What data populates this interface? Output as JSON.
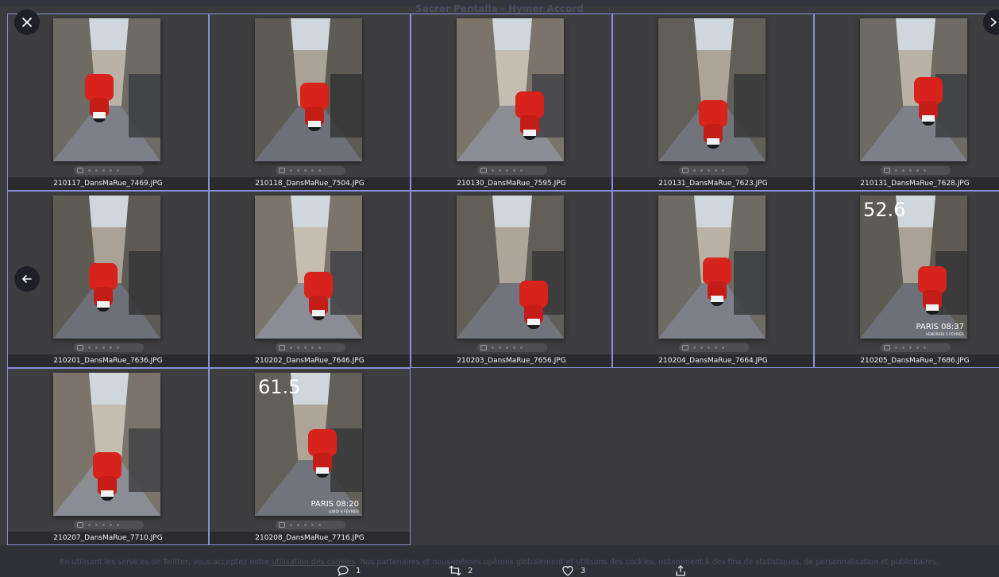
{
  "background_page": {
    "title": "Sacrer Pentalla - Hymer Accord",
    "cookie_text_before": "En utilisant les services de Twitter, vous acceptez notre",
    "cookie_link": "utilisation des cookies",
    "cookie_text_after": ". Nos partenaires et nous-mêmes opérons globalement et utilisons des cookies, notamment à des fins de statistiques, de personnalisation et publicitaires."
  },
  "viewer": {
    "close_icon": "close-icon",
    "prev_icon": "arrow-left-icon",
    "next_icon": "chevron-right-icon"
  },
  "thumbnails": [
    {
      "filename": "210117_DansMaRue_7469.JPG"
    },
    {
      "filename": "210118_DansMaRue_7504.JPG"
    },
    {
      "filename": "210130_DansMaRue_7595.JPG"
    },
    {
      "filename": "210131_DansMaRue_7623.JPG"
    },
    {
      "filename": "210131_DansMaRue_7628.JPG"
    },
    {
      "filename": "210201_DansMaRue_7636.JPG"
    },
    {
      "filename": "210202_DansMaRue_7646.JPG"
    },
    {
      "filename": "210203_DansMaRue_7656.JPG"
    },
    {
      "filename": "210204_DansMaRue_7664.JPG"
    },
    {
      "filename": "210205_DansMaRue_7686.JPG",
      "overlay_top": "52.6",
      "overlay_bottom": "PARIS 08:37",
      "overlay_bottom_small": "VENDREDI 5 FÉVRIER"
    },
    {
      "filename": "210207_DansMaRue_7710.JPG"
    },
    {
      "filename": "210208_DansMaRue_7716.JPG",
      "overlay_top": "61.5",
      "overlay_bottom": "PARIS 08:20",
      "overlay_bottom_small": "LUNDI 8 FÉVRIER"
    }
  ],
  "actions": {
    "reply_count": "1",
    "retweet_count": "2",
    "like_count": "3"
  },
  "colors": {
    "selection_border": "#8a8fd6",
    "scooter_red": "#d8221c",
    "background": "#3a3a3e"
  }
}
